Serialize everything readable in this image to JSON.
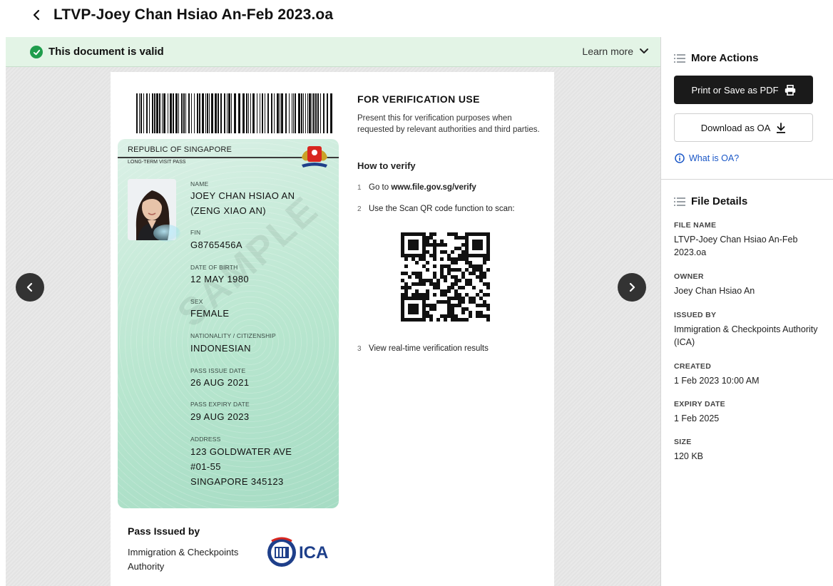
{
  "header": {
    "title": "LTVP-Joey Chan Hsiao An-Feb 2023.oa",
    "back_icon": "chevron-left-icon"
  },
  "status": {
    "valid_text": "This document is valid",
    "learn_more": "Learn more"
  },
  "card": {
    "country": "REPUBLIC OF SINGAPORE",
    "pass_type": "LONG-TERM VISIT PASS",
    "watermark": "SAMPLE",
    "fields": [
      {
        "label": "NAME",
        "value": "JOEY CHAN HSIAO AN",
        "value2": "(ZENG XIAO AN)"
      },
      {
        "label": "FIN",
        "value": "G8765456A"
      },
      {
        "label": "DATE OF BIRTH",
        "value": "12 MAY 1980"
      },
      {
        "label": "SEX",
        "value": "FEMALE"
      },
      {
        "label": "NATIONALITY / CITIZENSHIP",
        "value": "INDONESIAN"
      },
      {
        "label": "PASS ISSUE DATE",
        "value": "26 AUG 2021"
      },
      {
        "label": "PASS EXPIRY DATE",
        "value": "29 AUG 2023"
      },
      {
        "label": "ADDRESS",
        "value": "123 GOLDWATER AVE",
        "value2": "#01-55",
        "value3": "SINGAPORE 345123"
      }
    ],
    "issued_by_title": "Pass Issued by",
    "issued_by_name": "Immigration & Checkpoints Authority",
    "ica_text": "ICA"
  },
  "verification": {
    "title": "FOR VERIFICATION USE",
    "description": "Present this for verification purposes when requested by relevant authorities and third parties.",
    "how_title": "How to verify",
    "steps": [
      {
        "num": "1",
        "text_prefix": "Go to ",
        "text_bold": "www.file.gov.sg/verify"
      },
      {
        "num": "2",
        "text": "Use the Scan QR code function to scan:"
      },
      {
        "num": "3",
        "text": "View real-time verification results"
      }
    ]
  },
  "sidebar": {
    "more_actions_title": "More Actions",
    "print_label": "Print or Save as PDF",
    "download_label": "Download as OA",
    "what_is_oa": "What is OA?",
    "file_details_title": "File Details",
    "details": [
      {
        "label": "FILE NAME",
        "value": "LTVP-Joey Chan Hsiao An-Feb 2023.oa"
      },
      {
        "label": "OWNER",
        "value": "Joey Chan Hsiao An"
      },
      {
        "label": "ISSUED BY",
        "value": "Immigration & Checkpoints Authority (ICA)"
      },
      {
        "label": "CREATED",
        "value": "1 Feb 2023 10:00 AM"
      },
      {
        "label": "EXPIRY DATE",
        "value": "1 Feb 2025"
      },
      {
        "label": "SIZE",
        "value": "120 KB"
      }
    ]
  },
  "colors": {
    "valid_green": "#1f9d4c",
    "valid_bar_bg": "#e3f4e6",
    "card_green": "#b8e6cf",
    "primary_button": "#1a1a1a",
    "link_blue": "#1a57c7"
  }
}
